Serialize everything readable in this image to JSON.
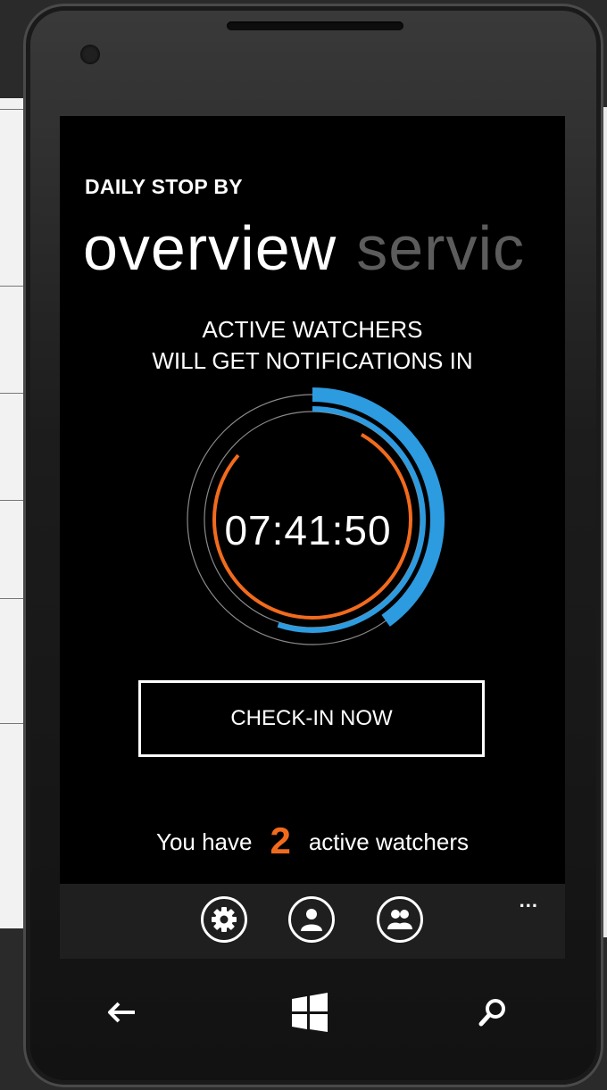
{
  "app": {
    "title": "DAILY STOP BY"
  },
  "pivot": {
    "items": [
      {
        "label": "overview",
        "active": true
      },
      {
        "label": "servic",
        "active": false
      }
    ]
  },
  "status": {
    "line1": "ACTIVE WATCHERS",
    "line2": "WILL GET NOTIFICATIONS IN"
  },
  "timer": {
    "countdown": "07:41:50",
    "outer_ring_fraction": 0.4,
    "inner_ring_fraction": 0.55,
    "colors": {
      "blue": "#2d9be0",
      "orange": "#f26b1d",
      "track": "#8a8a8a"
    }
  },
  "actions": {
    "checkin_label": "CHECK-IN NOW"
  },
  "watchers": {
    "prefix": "You have",
    "count": "2",
    "suffix": "active watchers"
  },
  "appbar": {
    "buttons": [
      {
        "icon": "gear-icon"
      },
      {
        "icon": "user-icon"
      },
      {
        "icon": "group-icon"
      }
    ],
    "more": "..."
  },
  "navbar": {
    "buttons": [
      {
        "icon": "back-arrow-icon"
      },
      {
        "icon": "windows-start-icon"
      },
      {
        "icon": "search-icon"
      }
    ]
  }
}
